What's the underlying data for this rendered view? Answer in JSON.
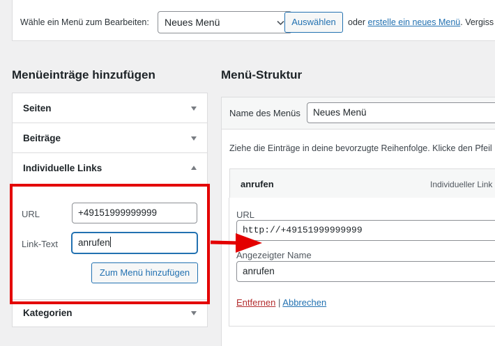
{
  "topbar": {
    "select_label": "Wähle ein Menü zum Bearbeiten:",
    "selected_menu": "Neues Menü",
    "select_button": "Auswählen",
    "or_text": "oder",
    "create_link": "erstelle ein neues Menü",
    "trailing_text": ". Vergiss"
  },
  "left": {
    "heading": "Menüeinträge hinzufügen",
    "sections": [
      {
        "label": "Seiten"
      },
      {
        "label": "Beiträge"
      },
      {
        "label": "Individuelle Links"
      },
      {
        "label": "Kategorien"
      }
    ],
    "custom_links": {
      "url_label": "URL",
      "url_value": "+49151999999999",
      "link_text_label": "Link-Text",
      "link_text_value": "anrufen",
      "add_button": "Zum Menü hinzufügen"
    }
  },
  "right": {
    "heading": "Menü-Struktur",
    "menu_name_label": "Name des Menüs",
    "menu_name_value": "Neues Menü",
    "instructions": "Ziehe die Einträge in deine bevorzugte Reihenfolge. Klicke den Pfeil",
    "item": {
      "title": "anrufen",
      "type": "Individueller Link",
      "url_label": "URL",
      "url_value": "http://+49151999999999",
      "nav_label": "Angezeigter Name",
      "nav_value": "anrufen",
      "remove": "Entfernen",
      "separator": "|",
      "cancel": "Abbrechen"
    }
  },
  "colors": {
    "accent": "#2271b1",
    "highlight_red": "#e30000",
    "remove_red": "#b32d2e"
  }
}
